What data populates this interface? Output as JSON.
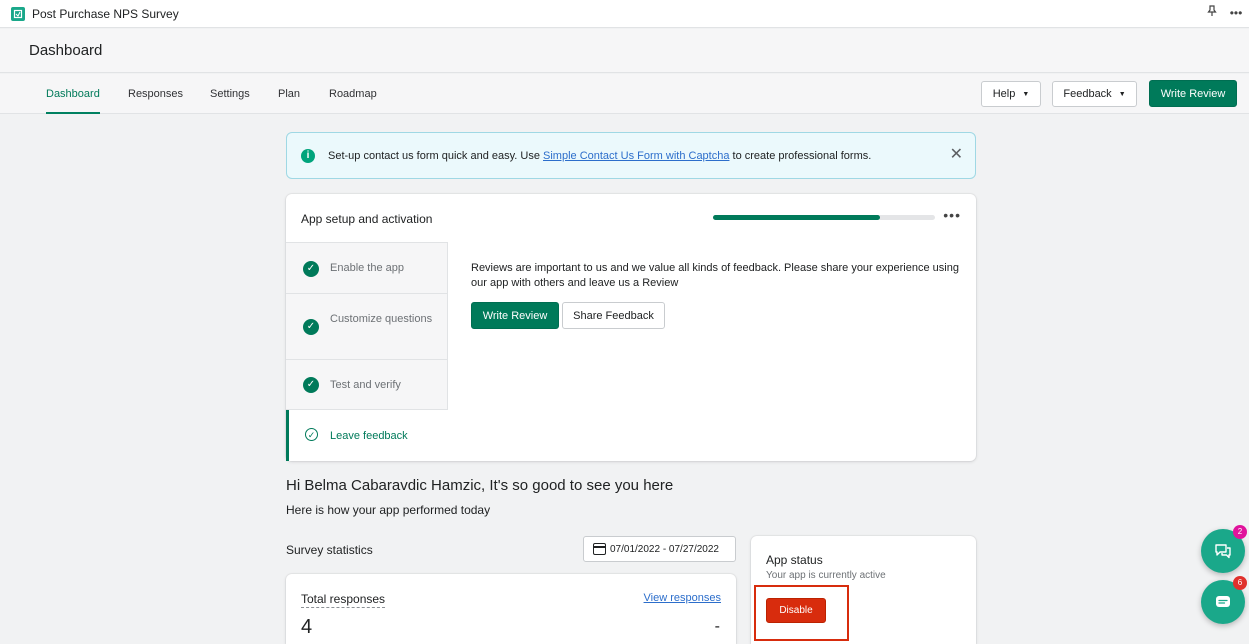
{
  "topbar": {
    "app_name": "Post Purchase NPS Survey",
    "pin_icon": "pin-icon",
    "more_icon": "more-icon"
  },
  "page": {
    "title": "Dashboard"
  },
  "nav": {
    "tabs": [
      {
        "label": "Dashboard",
        "active": true
      },
      {
        "label": "Responses"
      },
      {
        "label": "Settings"
      },
      {
        "label": "Plan"
      },
      {
        "label": "Roadmap"
      }
    ],
    "help_label": "Help",
    "feedback_label": "Feedback",
    "write_review_label": "Write Review"
  },
  "banner": {
    "text_before": "Set-up contact us form quick and easy. Use ",
    "link_text": "Simple Contact Us Form with Captcha",
    "text_after": " to create professional forms."
  },
  "setup": {
    "title": "App setup and activation",
    "progress_fraction": 0.75,
    "steps": [
      {
        "label": "Enable the app",
        "done": true
      },
      {
        "label": "Customize questions",
        "done": true
      },
      {
        "label": "Test and verify",
        "done": true
      },
      {
        "label": "Leave feedback",
        "active": true
      }
    ],
    "feedback_text": "Reviews are important to us and we value all kinds of feedback. Please share your experience using our app with others and leave us a Review",
    "write_review_label": "Write Review",
    "share_feedback_label": "Share Feedback"
  },
  "greeting": {
    "title": "Hi Belma Cabaravdic Hamzic, It's so good to see you here",
    "subtitle": "Here is how your app performed today"
  },
  "stats": {
    "title": "Survey statistics",
    "date_range": "07/01/2022 - 07/27/2022",
    "total_title": "Total responses",
    "view_link": "View responses",
    "total_value": "4",
    "change": "-"
  },
  "status": {
    "title": "App status",
    "subtitle": "Your app is currently active",
    "disable_label": "Disable"
  },
  "fabs": {
    "chat_badge": "2",
    "message_badge": "6",
    "chat_badge_color": "#e0139c",
    "message_badge_color": "#e0312c"
  },
  "colors": {
    "accent": "#008060",
    "danger": "#d82c0d",
    "info_bg": "#ebf9fc"
  }
}
